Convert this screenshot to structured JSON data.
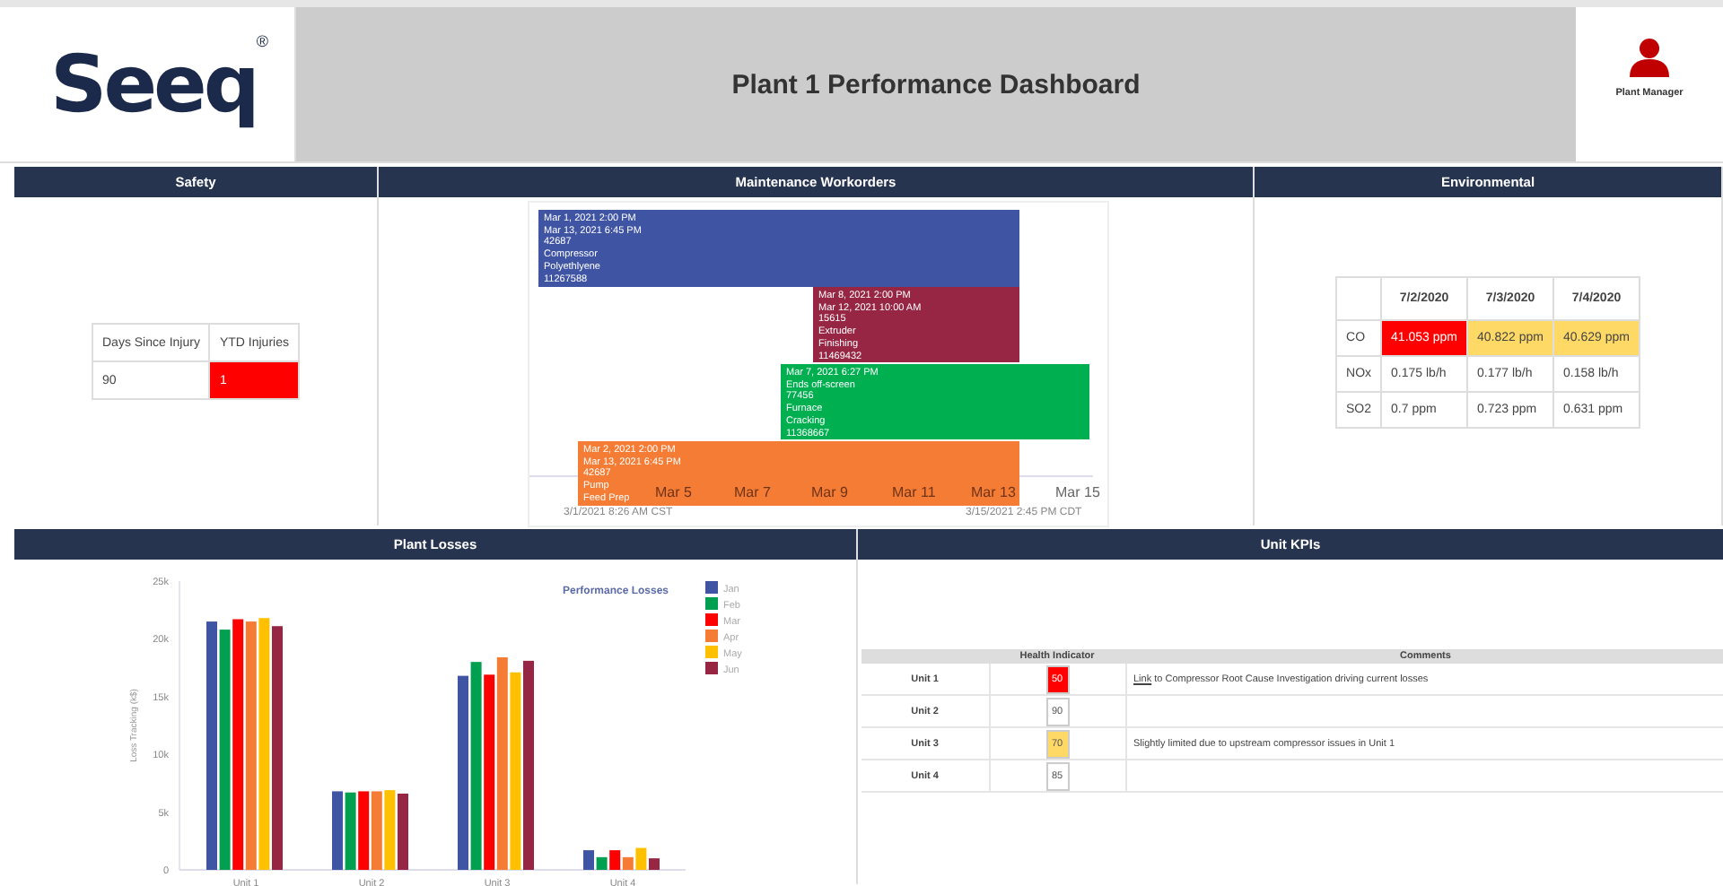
{
  "header": {
    "logo": "Seeq",
    "logo_mark": "®",
    "title": "Plant 1 Performance Dashboard",
    "user": "Plant Manager"
  },
  "safety": {
    "title": "Safety",
    "columns": [
      "Days Since Injury",
      "YTD Injuries"
    ],
    "cells": [
      {
        "text": "90"
      },
      {
        "text": "1",
        "color": "#ff0000"
      }
    ]
  },
  "maintenance": {
    "title": "Maintenance Workorders",
    "bars": [
      {
        "color": "#3f54a3",
        "lines": [
          "Mar 1, 2021 2:00 PM",
          "Mar 13, 2021 6:45 PM",
          "42687",
          "Compressor",
          "Polyethlyene",
          "11267588"
        ]
      },
      {
        "color": "#962643",
        "lines": [
          "Mar 8, 2021 2:00 PM",
          "Mar 12, 2021 10:00 AM",
          "15615",
          "Extruder",
          "Finishing",
          "11469432"
        ]
      },
      {
        "color": "#00b050",
        "lines": [
          "Mar 7, 2021 6:27 PM",
          "Ends off-screen",
          "77456",
          "Furnace",
          "Cracking",
          "11368667"
        ]
      },
      {
        "color": "#f47c35",
        "lines": [
          "Mar 2, 2021 2:00 PM",
          "Mar 13, 2021 6:45 PM",
          "42687",
          "Pump",
          "Feed Prep"
        ]
      }
    ],
    "axis_labels": [
      "Mar 5",
      "Mar 7",
      "Mar 9",
      "Mar 11",
      "Mar 13",
      "Mar 15"
    ],
    "range_start": "3/1/2021 8:26 AM CST",
    "range_end": "3/15/2021 2:45 PM CDT"
  },
  "environmental": {
    "title": "Environmental",
    "columns": [
      "7/2/2020",
      "7/3/2020",
      "7/4/2020"
    ],
    "rows": [
      {
        "label": "CO",
        "cells": [
          {
            "text": "41.053 ppm",
            "color": "#ff0000"
          },
          {
            "text": "40.822 ppm",
            "color": "#ffd966"
          },
          {
            "text": "40.629 ppm",
            "color": "#ffd966"
          }
        ]
      },
      {
        "label": "NOx",
        "cells": [
          {
            "text": "0.175 lb/h"
          },
          {
            "text": "0.177 lb/h"
          },
          {
            "text": "0.158 lb/h"
          }
        ]
      },
      {
        "label": "SO2",
        "cells": [
          {
            "text": "0.7 ppm"
          },
          {
            "text": "0.723 ppm"
          },
          {
            "text": "0.631 ppm"
          }
        ]
      }
    ]
  },
  "plant_losses": {
    "title": "Plant Losses",
    "chart_data": {
      "type": "bar",
      "title": "Performance Losses",
      "legend": true,
      "ylabel": "Loss Tracking (k$)",
      "categories": [
        "Unit 1",
        "Unit 2",
        "Unit 3",
        "Unit 4"
      ],
      "ylim": [
        0,
        25000
      ],
      "yticks": [
        {
          "value": 0,
          "label": "0"
        },
        {
          "value": 5000,
          "label": "5k"
        },
        {
          "value": 10000,
          "label": "10k"
        },
        {
          "value": 15000,
          "label": "15k"
        },
        {
          "value": 20000,
          "label": "20k"
        },
        {
          "value": 25000,
          "label": "25k"
        }
      ],
      "series": [
        {
          "name": "Jan",
          "color": "#3f54a3",
          "values": [
            21500,
            6800,
            16800,
            1700
          ]
        },
        {
          "name": "Feb",
          "color": "#00a050",
          "values": [
            20800,
            6700,
            18000,
            1100
          ]
        },
        {
          "name": "Mar",
          "color": "#ff0000",
          "values": [
            21700,
            6800,
            16900,
            1700
          ]
        },
        {
          "name": "Apr",
          "color": "#f47c35",
          "values": [
            21500,
            6800,
            18400,
            1100
          ]
        },
        {
          "name": "May",
          "color": "#ffc000",
          "values": [
            21800,
            6900,
            17100,
            1900
          ]
        },
        {
          "name": "Jun",
          "color": "#962643",
          "values": [
            21100,
            6600,
            18100,
            1000
          ]
        }
      ]
    }
  },
  "unit_kpis": {
    "title": "Unit KPIs",
    "columns": [
      "Health Indicator",
      "Comments"
    ],
    "rows": [
      {
        "unit": "Unit 1",
        "health": "50",
        "color": "#ff0000",
        "link": "Link",
        "comment": " to Compressor Root Cause Investigation driving current losses"
      },
      {
        "unit": "Unit 2",
        "health": "90",
        "color": "#ffffff"
      },
      {
        "unit": "Unit 3",
        "health": "70",
        "color": "#ffd966",
        "comment": "Slightly limited due to upstream compressor issues in Unit 1"
      },
      {
        "unit": "Unit 4",
        "health": "85",
        "color": "#ffffff"
      }
    ]
  }
}
